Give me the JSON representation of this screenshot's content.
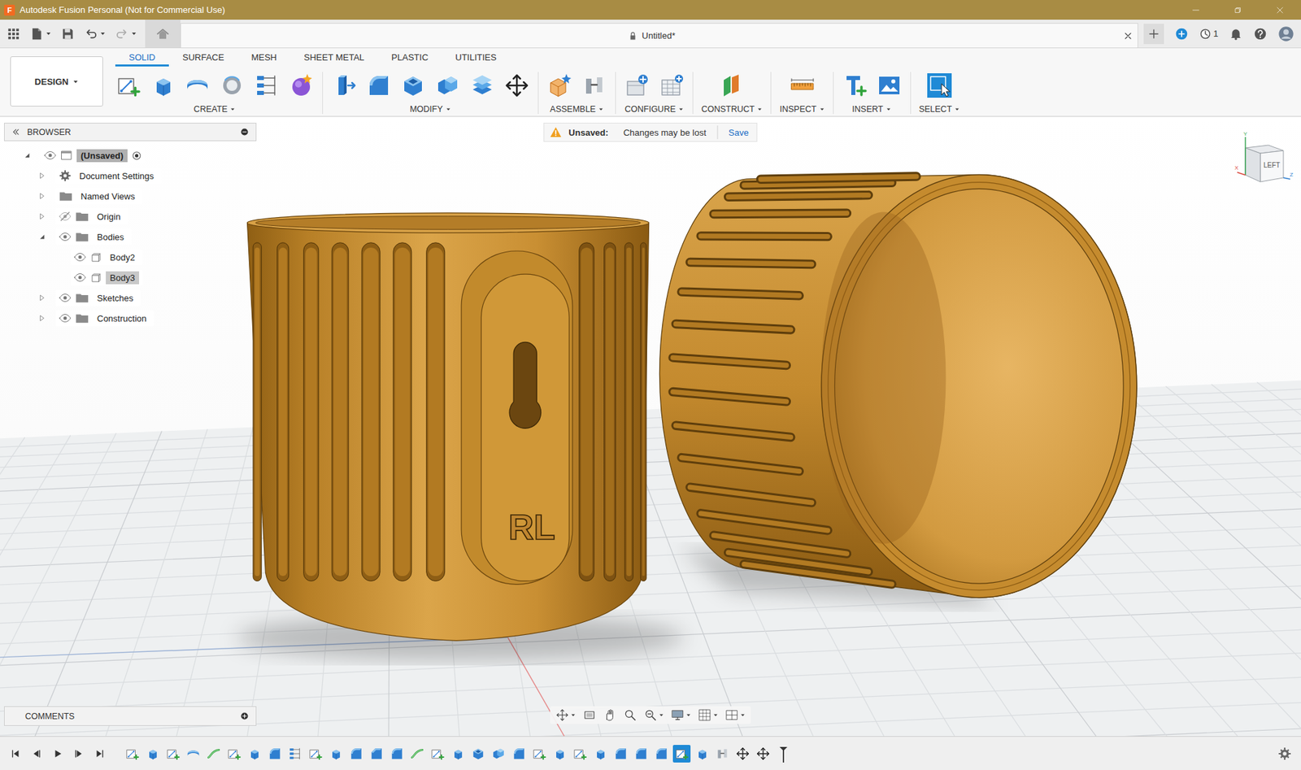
{
  "window": {
    "title": "Autodesk Fusion Personal (Not for Commercial Use)",
    "logo": "F"
  },
  "document_tab": {
    "title": "Untitled*"
  },
  "jobs": {
    "count": "1"
  },
  "workspace": {
    "label": "DESIGN"
  },
  "toolbar_tabs": [
    {
      "label": "SOLID",
      "selected": true
    },
    {
      "label": "SURFACE",
      "selected": false
    },
    {
      "label": "MESH",
      "selected": false
    },
    {
      "label": "SHEET METAL",
      "selected": false
    },
    {
      "label": "PLASTIC",
      "selected": false
    },
    {
      "label": "UTILITIES",
      "selected": false
    }
  ],
  "tool_groups": [
    {
      "label": "CREATE"
    },
    {
      "label": "MODIFY"
    },
    {
      "label": "ASSEMBLE"
    },
    {
      "label": "CONFIGURE"
    },
    {
      "label": "CONSTRUCT"
    },
    {
      "label": "INSPECT"
    },
    {
      "label": "INSERT"
    },
    {
      "label": "SELECT"
    }
  ],
  "browser": {
    "title": "BROWSER",
    "items": [
      {
        "label": "(Unsaved)",
        "depth": 0,
        "kind": "root",
        "expandable": true,
        "expanded": true,
        "has_eye": true,
        "visible": true,
        "active": true,
        "selected": false
      },
      {
        "label": "Document Settings",
        "depth": 1,
        "kind": "settings",
        "expandable": true,
        "expanded": false,
        "has_eye": false,
        "visible": false,
        "active": false,
        "selected": false
      },
      {
        "label": "Named Views",
        "depth": 1,
        "kind": "folder",
        "expandable": true,
        "expanded": false,
        "has_eye": false,
        "visible": false,
        "active": false,
        "selected": false
      },
      {
        "label": "Origin",
        "depth": 1,
        "kind": "folder",
        "expandable": true,
        "expanded": false,
        "has_eye": true,
        "visible": false,
        "active": false,
        "selected": false
      },
      {
        "label": "Bodies",
        "depth": 1,
        "kind": "folder",
        "expandable": true,
        "expanded": true,
        "has_eye": true,
        "visible": true,
        "active": false,
        "selected": false
      },
      {
        "label": "Body2",
        "depth": 2,
        "kind": "body",
        "expandable": false,
        "expanded": false,
        "has_eye": true,
        "visible": true,
        "active": false,
        "selected": false
      },
      {
        "label": "Body3",
        "depth": 2,
        "kind": "body",
        "expandable": false,
        "expanded": false,
        "has_eye": true,
        "visible": true,
        "active": false,
        "selected": true
      },
      {
        "label": "Sketches",
        "depth": 1,
        "kind": "folder",
        "expandable": true,
        "expanded": false,
        "has_eye": true,
        "visible": true,
        "active": false,
        "selected": false
      },
      {
        "label": "Construction",
        "depth": 1,
        "kind": "folder",
        "expandable": true,
        "expanded": false,
        "has_eye": true,
        "visible": true,
        "active": false,
        "selected": false
      }
    ]
  },
  "banner": {
    "title": "Unsaved:",
    "message": "Changes may be lost",
    "action": "Save"
  },
  "viewcube": {
    "face": "LEFT",
    "axes": {
      "y": "Y",
      "x": "X",
      "z": "Z"
    }
  },
  "model": {
    "engraving": "RL"
  },
  "comments": {
    "title": "COMMENTS"
  },
  "timeline": {
    "items": [
      {
        "kind": "sketch",
        "selected": false
      },
      {
        "kind": "extrude",
        "selected": false
      },
      {
        "kind": "sketch",
        "selected": false
      },
      {
        "kind": "revolve",
        "selected": false
      },
      {
        "kind": "sweep",
        "selected": false
      },
      {
        "kind": "sketch",
        "selected": false
      },
      {
        "kind": "extrude",
        "selected": false
      },
      {
        "kind": "fillet",
        "selected": false
      },
      {
        "kind": "pattern",
        "selected": false
      },
      {
        "kind": "sketch",
        "selected": false
      },
      {
        "kind": "extrude",
        "selected": false
      },
      {
        "kind": "fillet",
        "selected": false
      },
      {
        "kind": "chamfer",
        "selected": false
      },
      {
        "kind": "fillet",
        "selected": false
      },
      {
        "kind": "sweep",
        "selected": false
      },
      {
        "kind": "sketch",
        "selected": false
      },
      {
        "kind": "extrude",
        "selected": false
      },
      {
        "kind": "shell",
        "selected": false
      },
      {
        "kind": "combine",
        "selected": false
      },
      {
        "kind": "fillet",
        "selected": false
      },
      {
        "kind": "sketch",
        "selected": false
      },
      {
        "kind": "extrude",
        "selected": false
      },
      {
        "kind": "sketch",
        "selected": false
      },
      {
        "kind": "extrude",
        "selected": false
      },
      {
        "kind": "fillet",
        "selected": false
      },
      {
        "kind": "fillet",
        "selected": false
      },
      {
        "kind": "fillet",
        "selected": false
      },
      {
        "kind": "sketch",
        "selected": true
      },
      {
        "kind": "extrude",
        "selected": false
      },
      {
        "kind": "joint",
        "selected": false
      },
      {
        "kind": "move",
        "selected": false
      },
      {
        "kind": "move",
        "selected": false
      }
    ]
  }
}
